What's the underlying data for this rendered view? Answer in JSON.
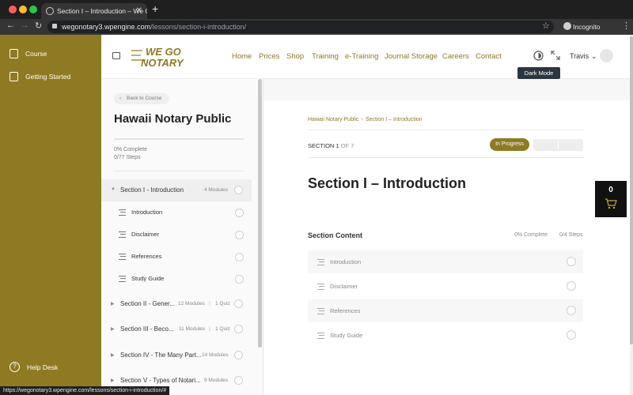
{
  "browser": {
    "tab_title": "Section I – Introduction – We G",
    "url_host": "wegonotary3.wpengine.com",
    "url_path": "/lessons/section-i-introduction/",
    "incognito_label": "Incognito",
    "status_url": "https://wegonotary3.wpengine.com/lessons/section-i-introduction/#"
  },
  "sidebar": {
    "items": [
      {
        "label": "Course",
        "icon": "book-icon"
      },
      {
        "label": "Getting Started",
        "icon": "checkbox-icon"
      }
    ],
    "help_label": "Help Desk"
  },
  "header": {
    "logo_line1": "WE GO",
    "logo_line2": "NOTARY",
    "nav": [
      "Home",
      "Prices",
      "Shop",
      "Training",
      "e-Training",
      "Journal Storage",
      "Careers",
      "Contact"
    ],
    "user_name": "Travis",
    "tooltip": "Dark Mode"
  },
  "course": {
    "back_label": "Back to Course",
    "title": "Hawaii Notary Public",
    "progress": 0,
    "percent_text": "0% Complete",
    "steps_text": "0/77 Steps",
    "sections": [
      {
        "title": "Section I - Introduction",
        "meta1": "4 Modules",
        "meta2": ""
      },
      {
        "title": "Section II - Gener...",
        "meta1": "12 Modules",
        "meta2": "1 Quiz"
      },
      {
        "title": "Section III - Beco...",
        "meta1": "11 Modules",
        "meta2": "1 Quiz"
      },
      {
        "title": "Section IV - The Many Part...",
        "meta1": "24 Modules",
        "meta2": ""
      },
      {
        "title": "Section V - Types of Notari...",
        "meta1": "9 Modules",
        "meta2": ""
      }
    ],
    "lessons": [
      "Introduction",
      "Disclaimer",
      "References",
      "Study Guide"
    ]
  },
  "main": {
    "breadcrumb_course": "Hawaii Notary Public",
    "breadcrumb_sep": "›",
    "breadcrumb_section": "Section I – Introduction",
    "section_label": "SECTION",
    "section_num": "1",
    "section_of": "OF 7",
    "status_badge": "In Progress",
    "heading": "Section I – Introduction",
    "content_label": "Section Content",
    "content_percent": "0% Complete",
    "content_steps": "0/4 Steps",
    "content_items": [
      "Introduction",
      "Disclaimer",
      "References",
      "Study Guide"
    ]
  },
  "cart": {
    "count": "0"
  },
  "colors": {
    "brand": "#8e7a22",
    "dark": "#1f1f1f"
  }
}
